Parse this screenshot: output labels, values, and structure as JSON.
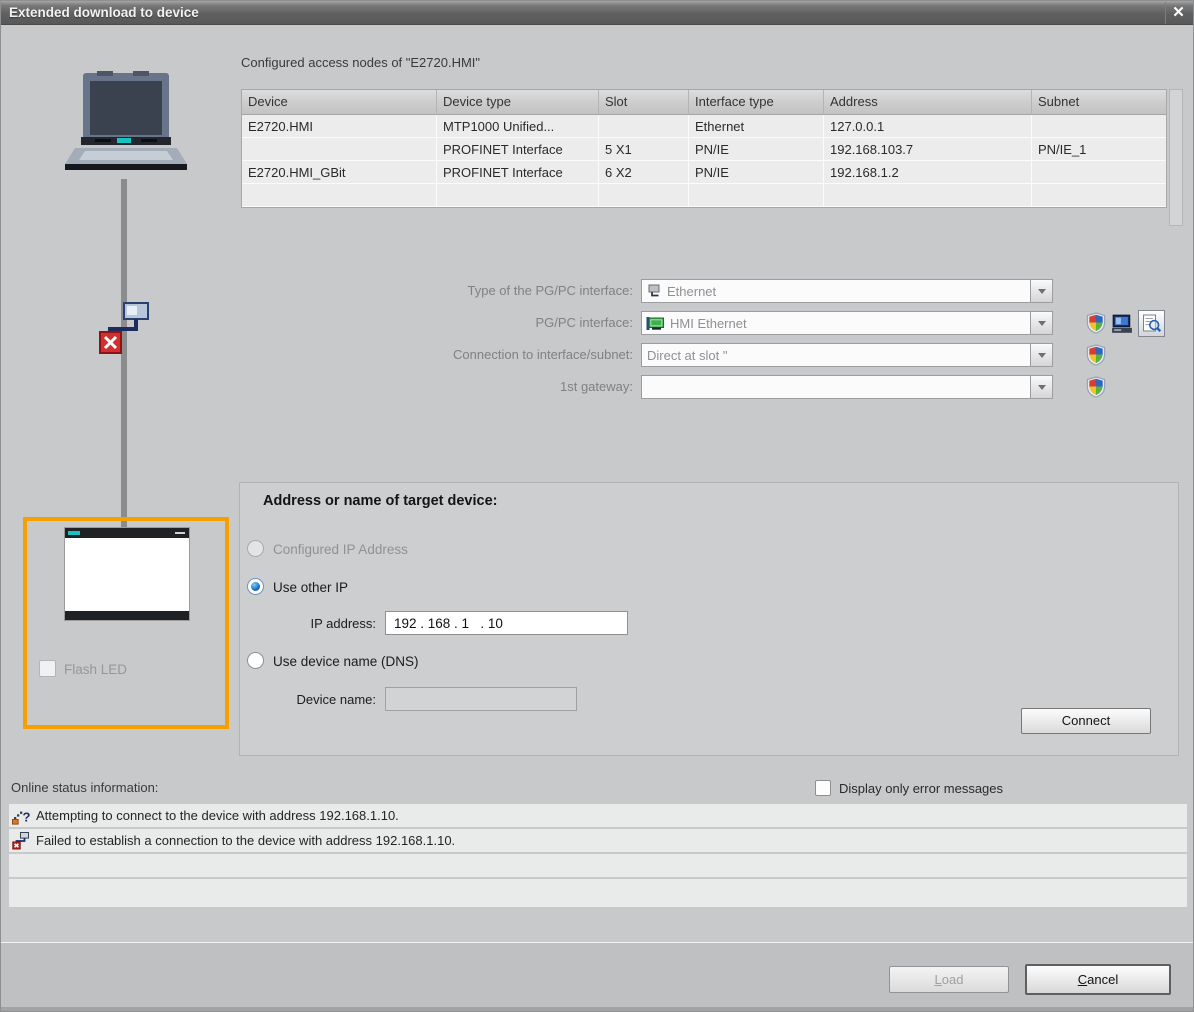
{
  "window": {
    "title": "Extended download to device",
    "close_glyph": "✕"
  },
  "colors": {
    "accent_orange": "#f5a000",
    "error_red": "#c7251d",
    "selected_radio_blue": "#1b74c8",
    "titlebar_gray": "#606060"
  },
  "icons": {
    "close": "✕",
    "dropdown_arrow": "▼",
    "attempting_glyph": "?",
    "failed_glyph": "x"
  },
  "access_nodes": {
    "caption": "Configured access nodes of \"E2720.HMI\"",
    "columns": [
      "Device",
      "Device type",
      "Slot",
      "Interface type",
      "Address",
      "Subnet"
    ],
    "rows": [
      [
        "E2720.HMI",
        "MTP1000 Unified...",
        "",
        "Ethernet",
        "127.0.0.1",
        ""
      ],
      [
        "",
        "PROFINET Interface",
        "5 X1",
        "PN/IE",
        "192.168.103.7",
        "PN/IE_1"
      ],
      [
        "E2720.HMI_GBit",
        "PROFINET Interface",
        "6 X2",
        "PN/IE",
        "192.168.1.2",
        ""
      ],
      [
        "",
        "",
        "",
        "",
        "",
        ""
      ]
    ]
  },
  "pgpc": {
    "type_label": "Type of the PG/PC interface:",
    "type_value": "Ethernet",
    "interface_label": "PG/PC interface:",
    "interface_value": "HMI Ethernet",
    "connection_label": "Connection to interface/subnet:",
    "connection_value": "Direct at slot \"",
    "gateway_label": "1st gateway:",
    "gateway_value": ""
  },
  "target": {
    "heading": "Address or name of target device:",
    "configured_ip_label": "Configured IP Address",
    "use_other_ip_label": "Use other IP",
    "ip_label": "IP address:",
    "ip_value": "192 . 168 . 1   . 10",
    "dns_label": "Use device name (DNS)",
    "device_name_label": "Device name:",
    "device_name_value": "",
    "connect_label": "Connect"
  },
  "left_panel": {
    "flash_led_label": "Flash LED"
  },
  "status": {
    "label": "Online status information:",
    "filter_label": "Display only error messages",
    "messages": [
      "Attempting to connect to the device with address 192.168.1.10.",
      "Failed to establish a connection to the device with address 192.168.1.10."
    ]
  },
  "footer": {
    "load_label": "Load",
    "cancel_label": "Cancel"
  }
}
